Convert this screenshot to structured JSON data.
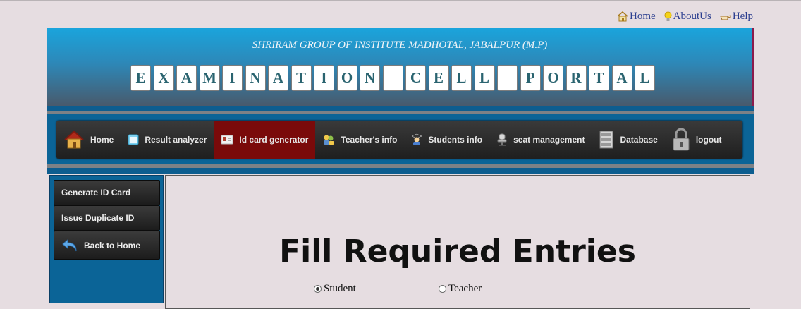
{
  "toplinks": [
    {
      "label": "Home",
      "icon": "house-icon"
    },
    {
      "label": "AboutUs",
      "icon": "lightbulb-icon"
    },
    {
      "label": "Help",
      "icon": "pointing-hand-icon"
    }
  ],
  "header": {
    "institute": "SHRIRAM GROUP OF INSTITUTE MADHOTAL, JABALPUR (M.P)",
    "title_letters": [
      "E",
      "X",
      "A",
      "M",
      "I",
      "N",
      "A",
      "T",
      "I",
      "O",
      "N",
      "",
      "C",
      "E",
      "L",
      "L",
      "",
      "P",
      "O",
      "R",
      "T",
      "A",
      "L"
    ]
  },
  "nav": {
    "items": [
      {
        "label": "Home",
        "icon": "house-icon"
      },
      {
        "label": "Result analyzer",
        "icon": "window-icon"
      },
      {
        "label": "Id card generator",
        "icon": "id-card-icon",
        "active": true
      },
      {
        "label": "Teacher's info",
        "icon": "people-icon"
      },
      {
        "label": "Students info",
        "icon": "student-icon"
      },
      {
        "label": "seat management",
        "icon": "chair-icon"
      },
      {
        "label": "Database",
        "icon": "database-icon"
      },
      {
        "label": "logout",
        "icon": "padlock-icon"
      }
    ]
  },
  "sidebar": {
    "items": [
      {
        "label": "Generate ID Card"
      },
      {
        "label": "Issue Duplicate ID"
      },
      {
        "label": "Back to Home",
        "icon": "back-arrow-icon"
      }
    ]
  },
  "form": {
    "title": "Fill Required Entries",
    "radio_options": [
      {
        "label": "Student",
        "checked": true
      },
      {
        "label": "Teacher",
        "checked": false
      }
    ]
  },
  "colors": {
    "page_bg": "#e6dde1",
    "nav_active": "#7a0a0a",
    "band_blue": "#0b6497",
    "link_blue": "#2b3e8f"
  }
}
